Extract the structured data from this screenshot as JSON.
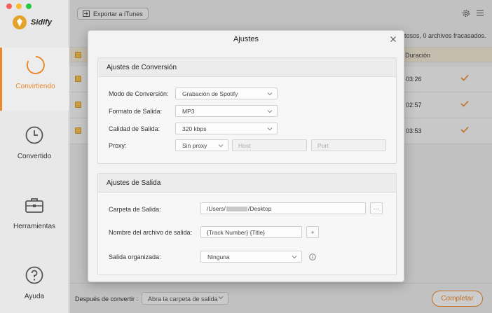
{
  "app": {
    "name": "Sidify"
  },
  "colors": {
    "accent": "#e9892d",
    "brand": "#e3a32a"
  },
  "sidebar": {
    "items": [
      {
        "label": "Convirtiendo",
        "icon": "converting-icon",
        "active": true
      },
      {
        "label": "Convertido",
        "icon": "clock-icon",
        "active": false
      },
      {
        "label": "Herramientas",
        "icon": "toolbox-icon",
        "active": false
      },
      {
        "label": "Ayuda",
        "icon": "help-icon",
        "active": false
      }
    ]
  },
  "toolbar": {
    "export_label": "Exportar a iTunes"
  },
  "list": {
    "status": "tosos, 0 archivos fracasados.",
    "duration_header": "Duración",
    "rows": [
      {
        "duration": "03:26"
      },
      {
        "duration": "02:57"
      },
      {
        "duration": "03:53"
      }
    ]
  },
  "bottom": {
    "after_label": "Después de convertir :",
    "after_value": "Abra la carpeta de salida",
    "complete_label": "Completar"
  },
  "modal": {
    "title": "Ajustes",
    "conversion": {
      "heading": "Ajustes de Conversión",
      "mode_label": "Modo de Conversión:",
      "mode_value": "Grabación de Spotify",
      "format_label": "Formato de Salida:",
      "format_value": "MP3",
      "quality_label": "Calidad de Salida:",
      "quality_value": "320 kbps",
      "proxy_label": "Proxy:",
      "proxy_value": "Sin proxy",
      "host_placeholder": "Host",
      "port_placeholder": "Port"
    },
    "output": {
      "heading": "Ajustes de Salida",
      "folder_label": "Carpeta de Salida:",
      "folder_prefix": "/Users/",
      "folder_suffix": "/Desktop",
      "browse_label": "···",
      "filename_label": "Nombre del archivo de salida:",
      "filename_value": "{Track Number} {Title}",
      "add_label": "+",
      "organized_label": "Salida organizada:",
      "organized_value": "Ninguna"
    }
  }
}
